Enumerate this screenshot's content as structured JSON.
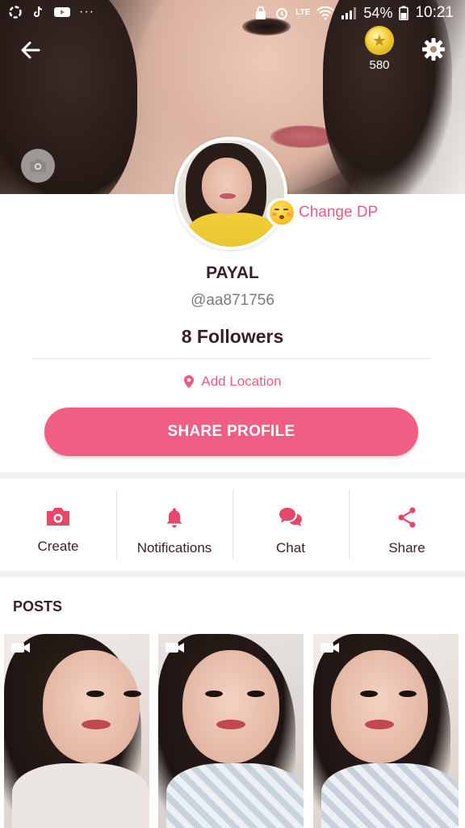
{
  "status_bar": {
    "battery": "54%",
    "time": "10:21",
    "network_label": "LTE"
  },
  "header": {
    "coins": "580"
  },
  "profile": {
    "change_dp_label": "Change DP",
    "name": "PAYAL",
    "handle": "@aa871756",
    "followers": "8 Followers",
    "location_label": "Add Location",
    "share_button": "SHARE PROFILE"
  },
  "actions": [
    {
      "label": "Create",
      "icon": "camera-icon"
    },
    {
      "label": "Notifications",
      "icon": "bell-icon"
    },
    {
      "label": "Chat",
      "icon": "chat-bubbles-icon"
    },
    {
      "label": "Share",
      "icon": "share-icon"
    }
  ],
  "posts": {
    "title": "POSTS",
    "items": [
      {
        "type": "video",
        "icon": "video-camera-icon"
      },
      {
        "type": "video",
        "icon": "video-camera-icon"
      },
      {
        "type": "video",
        "icon": "video-camera-icon"
      }
    ]
  },
  "colors": {
    "accent": "#f05f83",
    "accent_text": "#ef5b7c",
    "dark_text": "#3a1f26"
  }
}
